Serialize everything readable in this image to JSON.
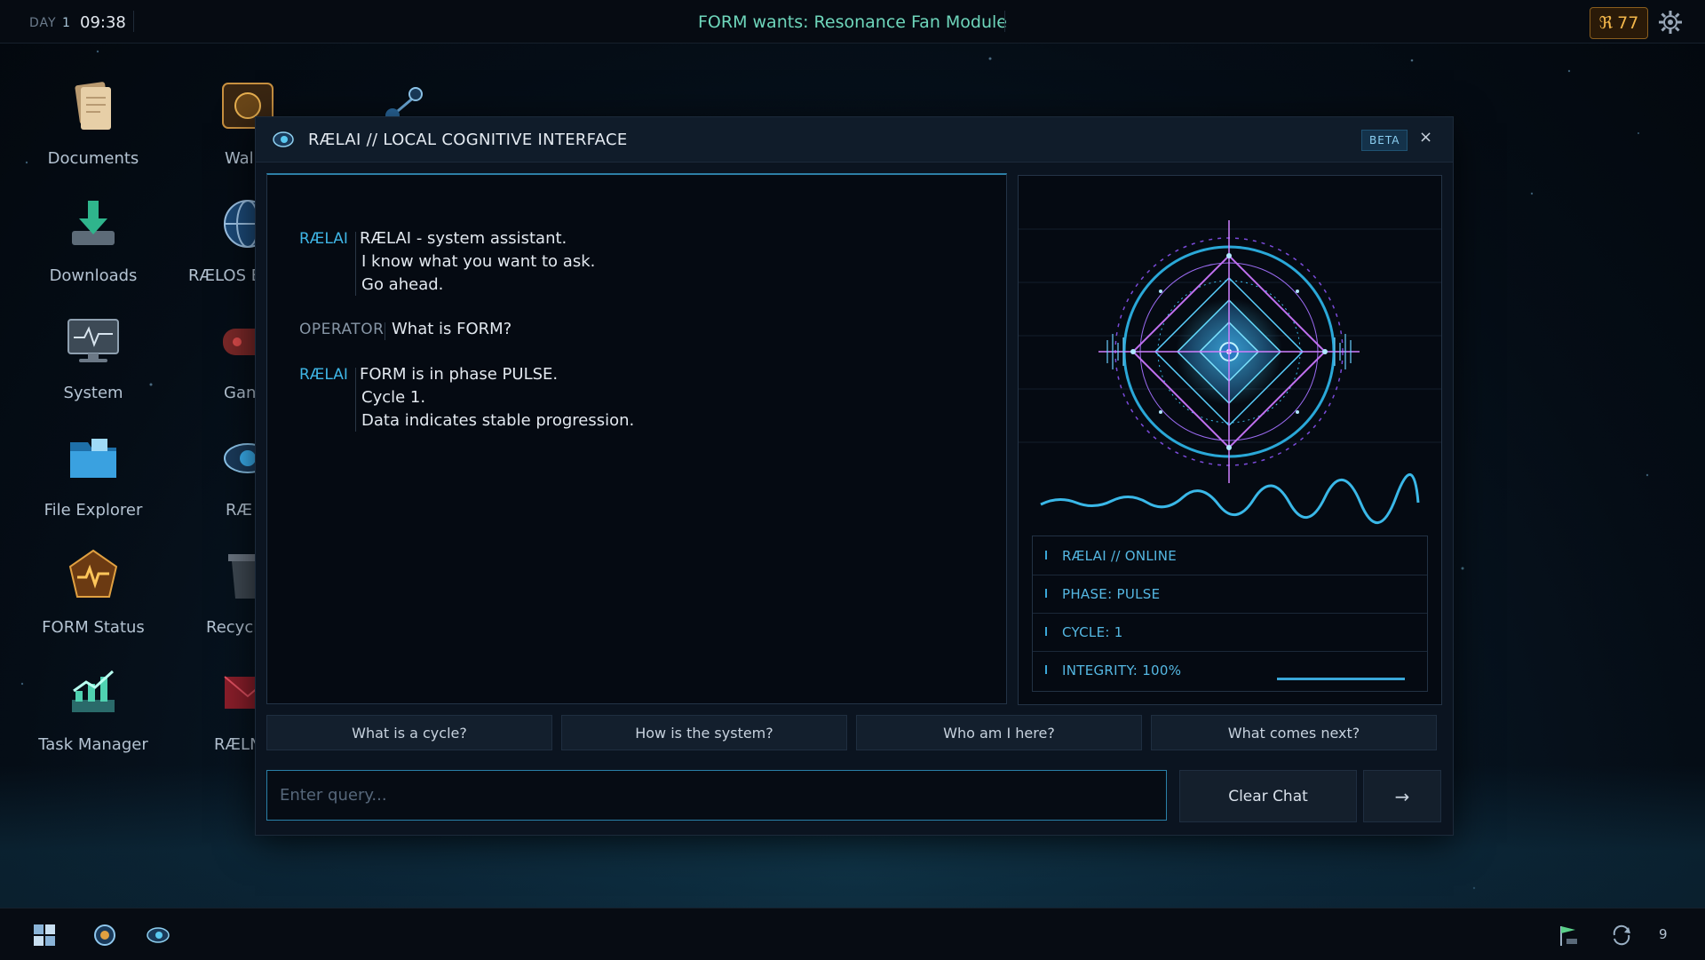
{
  "topbar": {
    "day_label": "DAY",
    "day_number": "1",
    "time": "09:38",
    "objective": "FORM wants: Resonance Fan Module",
    "currency_symbol": "ℜ",
    "currency_value": "77",
    "settings_icon": "gear-icon"
  },
  "desktop": {
    "icons": [
      {
        "label": "Documents",
        "icon": "documents-icon"
      },
      {
        "label": "Downloads",
        "icon": "downloads-icon"
      },
      {
        "label": "System",
        "icon": "system-monitor-icon"
      },
      {
        "label": "File Explorer",
        "icon": "folder-icon"
      },
      {
        "label": "FORM Status",
        "icon": "form-status-icon"
      },
      {
        "label": "Task Manager",
        "icon": "task-manager-icon"
      },
      {
        "label": "Wal",
        "icon": "wallet-icon"
      },
      {
        "label": "RÆLOS E",
        "icon": "globe-icon"
      },
      {
        "label": "Gan",
        "icon": "gamepad-icon"
      },
      {
        "label": "RÆ",
        "icon": "eye-icon"
      },
      {
        "label": "Recycl",
        "icon": "recycle-bin-icon"
      },
      {
        "label": "RÆLN",
        "icon": "mail-icon"
      }
    ]
  },
  "window": {
    "title": "RÆLAI // LOCAL COGNITIVE INTERFACE",
    "badge": "BETA",
    "close_label": "×"
  },
  "chat": {
    "messages": [
      {
        "sender": "RÆLAI",
        "lines": [
          "RÆLAI - system assistant.",
          "I know what you want to ask.",
          "Go ahead."
        ]
      },
      {
        "sender": "OPERATOR",
        "lines": [
          "What is FORM?"
        ]
      },
      {
        "sender": "RÆLAI",
        "lines": [
          "FORM is in phase PULSE.",
          "Cycle 1.",
          "Data indicates stable progression."
        ]
      }
    ]
  },
  "status": {
    "online": "RÆLAI // ONLINE",
    "phase": "PHASE: PULSE",
    "cycle": "CYCLE: 1",
    "integrity": "INTEGRITY: 100%",
    "integrity_level": 1.0
  },
  "suggestions": [
    "What is a cycle?",
    "How is the system?",
    "Who am I here?",
    "What comes next?"
  ],
  "input": {
    "placeholder": "Enter query...",
    "value": ""
  },
  "buttons": {
    "clear": "Clear Chat",
    "send": "→"
  },
  "taskbar": {
    "count": "9"
  },
  "colors": {
    "accent": "#3fb6e6",
    "objective": "#6ed6bb",
    "currency": "#f2b64a"
  }
}
